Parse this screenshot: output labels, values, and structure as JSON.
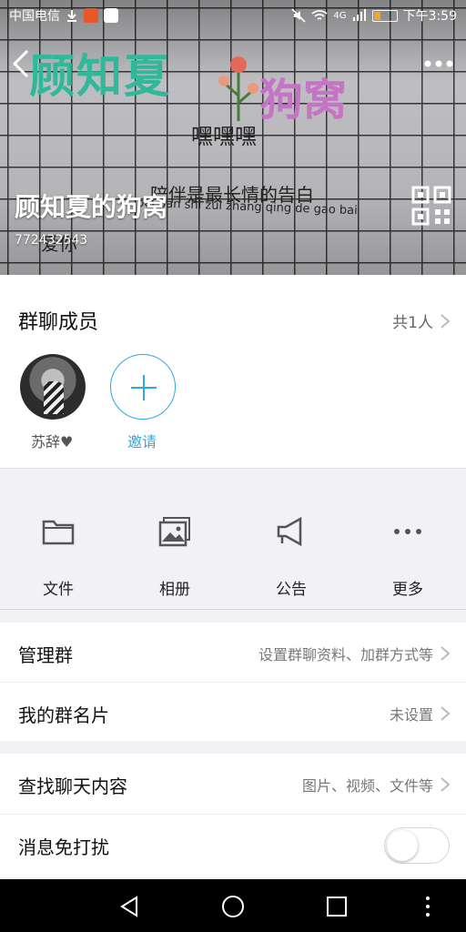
{
  "status_bar": {
    "carrier": "中国电信",
    "network": "4G",
    "time": "下午3:59"
  },
  "header": {
    "group_name": "顾知夏的狗窝",
    "group_id": "772432543",
    "cover_text": {
      "title_left": "顾知夏",
      "title_right": "狗窝",
      "exclaim": "嘿嘿嘿",
      "line1": "陪伴是最长情的告白",
      "line2": "pei ban shi zui zhang qing de gao bai",
      "line3": "爱你"
    }
  },
  "members": {
    "title": "群聊成员",
    "count": "共1人",
    "list": [
      {
        "name": "苏辞♥"
      }
    ],
    "invite_label": "邀请"
  },
  "actions": [
    {
      "label": "文件",
      "icon": "folder-icon"
    },
    {
      "label": "相册",
      "icon": "album-icon"
    },
    {
      "label": "公告",
      "icon": "megaphone-icon"
    },
    {
      "label": "更多",
      "icon": "more-dots-icon"
    }
  ],
  "settings": [
    {
      "label": "管理群",
      "value": "设置群聊资料、加群方式等"
    },
    {
      "label": "我的群名片",
      "value": "未设置"
    },
    {
      "label": "查找聊天内容",
      "value": "图片、视频、文件等"
    },
    {
      "label": "消息免打扰",
      "toggle": false
    }
  ],
  "colors": {
    "accent": "#2fa8e0",
    "cover_title_green": "#2fb89a",
    "cover_title_pink": "#c573c4"
  }
}
